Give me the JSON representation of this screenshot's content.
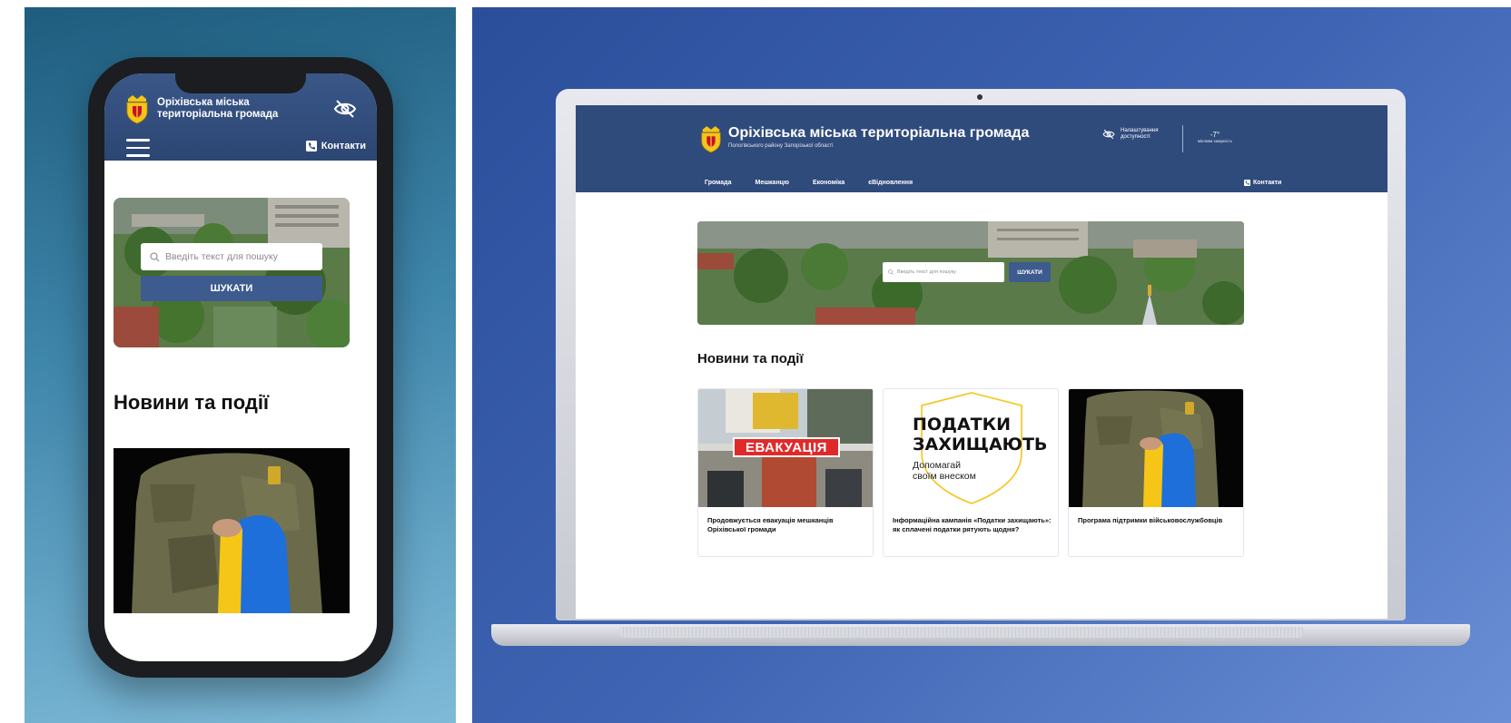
{
  "mobile": {
    "header": {
      "title_line1": "Оріхівська міська",
      "title_line2": "територіальна громада",
      "contacts_label": "Контакти"
    },
    "search": {
      "placeholder": "Введіть текст для пошуку",
      "button_label": "ШУКАТИ"
    },
    "news_title": "Новини та події"
  },
  "desktop": {
    "header": {
      "title": "Оріхівська міська територіальна громада",
      "subtitle": "Пологівського району Запорізької області",
      "accessibility_line1": "Налаштування",
      "accessibility_line2": "доступності",
      "weather_temp": "-7°",
      "weather_label": "мінлива хмарність"
    },
    "nav": {
      "items": [
        "Громада",
        "Мешканцю",
        "Економіка",
        "єВідновлення"
      ],
      "contacts_label": "Контакти"
    },
    "search": {
      "placeholder": "Введіть текст для пошуку",
      "button_label": "ШУКАТИ"
    },
    "news_title": "Новини та події",
    "cards": [
      {
        "caption": "Продовжується евакуація мешканців Оріхівської громади",
        "badge": "ЕВАКУАЦІЯ"
      },
      {
        "caption": "Інформаційна кампанія «Податки захищають»: як сплачені податки рятують щодня?",
        "poster_line1": "ПОДАТКИ",
        "poster_line2": "ЗАХИЩАЮТЬ",
        "poster_sub1": "Допомагай",
        "poster_sub2": "своїм внеском"
      },
      {
        "caption": "Програма підтримки військовослужбовців"
      }
    ]
  },
  "colors": {
    "header_blue": "#2f4b7c",
    "button_blue": "#3d5b8e",
    "flag_blue": "#1e6fd9",
    "flag_yellow": "#f5c518"
  }
}
